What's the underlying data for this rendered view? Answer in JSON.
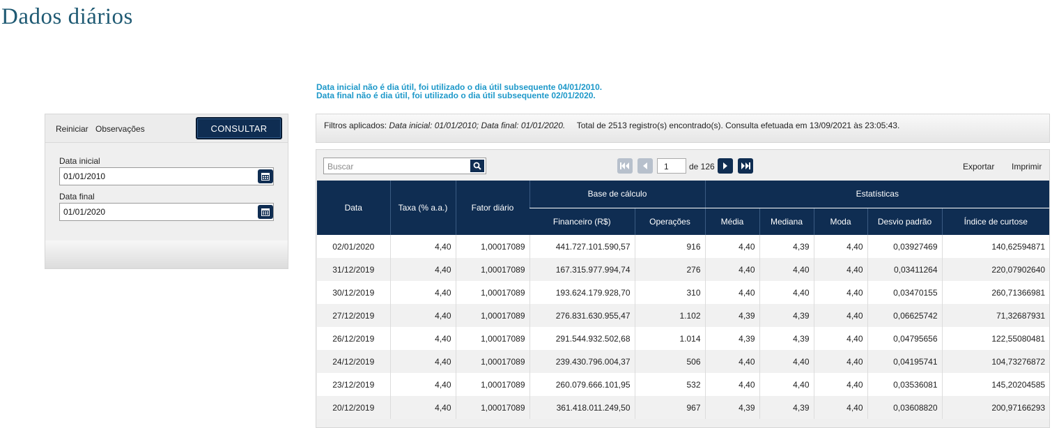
{
  "page": {
    "title": "Dados diários",
    "notice_1": "Data inicial não é dia útil, foi utilizado o dia útil subsequente 04/01/2010.",
    "notice_2": "Data final não é dia útil, foi utilizado o dia útil subsequente 02/01/2020."
  },
  "left_panel": {
    "reset_label": "Reiniciar",
    "notes_label": "Observações",
    "query_label": "CONSULTAR",
    "start_label": "Data inicial",
    "start_value": "01/01/2010",
    "end_label": "Data final",
    "end_value": "01/01/2020"
  },
  "filters": {
    "prefix": "Filtros aplicados:",
    "applied": "Data inicial: 01/01/2010; Data final: 01/01/2020.",
    "summary": "Total de 2513 registro(s) encontrado(s). Consulta efetuada em 13/09/2021 às 23:05:43."
  },
  "table_toolbar": {
    "search_placeholder": "Buscar",
    "page": "1",
    "page_of": "de 126",
    "export_label": "Exportar",
    "print_label": "Imprimir"
  },
  "table": {
    "headers": {
      "data": "Data",
      "taxa": "Taxa (% a.a.)",
      "fator": "Fator diário",
      "base_group": "Base de cálculo",
      "financeiro": "Financeiro (R$)",
      "operacoes": "Operações",
      "stats_group": "Estatísticas",
      "media": "Média",
      "mediana": "Mediana",
      "moda": "Moda",
      "desvio": "Desvio padrão",
      "curtose": "Índice de curtose"
    },
    "rows": [
      [
        "02/01/2020",
        "4,40",
        "1,00017089",
        "441.727.101.590,57",
        "916",
        "4,40",
        "4,39",
        "4,40",
        "0,03927469",
        "140,62594871"
      ],
      [
        "31/12/2019",
        "4,40",
        "1,00017089",
        "167.315.977.994,74",
        "276",
        "4,40",
        "4,40",
        "4,40",
        "0,03411264",
        "220,07902640"
      ],
      [
        "30/12/2019",
        "4,40",
        "1,00017089",
        "193.624.179.928,70",
        "310",
        "4,40",
        "4,40",
        "4,40",
        "0,03470155",
        "260,71366981"
      ],
      [
        "27/12/2019",
        "4,40",
        "1,00017089",
        "276.831.630.955,47",
        "1.102",
        "4,39",
        "4,39",
        "4,40",
        "0,06625742",
        "71,32687931"
      ],
      [
        "26/12/2019",
        "4,40",
        "1,00017089",
        "291.544.932.502,68",
        "1.014",
        "4,39",
        "4,39",
        "4,40",
        "0,04795656",
        "122,55080481"
      ],
      [
        "24/12/2019",
        "4,40",
        "1,00017089",
        "239.430.796.004,37",
        "506",
        "4,40",
        "4,40",
        "4,40",
        "0,04195741",
        "104,73276872"
      ],
      [
        "23/12/2019",
        "4,40",
        "1,00017089",
        "260.079.666.101,95",
        "532",
        "4,40",
        "4,40",
        "4,40",
        "0,03536081",
        "145,20204585"
      ],
      [
        "20/12/2019",
        "4,40",
        "1,00017089",
        "361.418.011.249,50",
        "967",
        "4,39",
        "4,39",
        "4,40",
        "0,03608820",
        "200,97166293"
      ]
    ]
  },
  "icons": {
    "calendar": "calendar-icon",
    "search": "search-icon",
    "first": "first-page-icon",
    "prev": "prev-page-icon",
    "next": "next-page-icon",
    "last": "last-page-icon"
  },
  "colors": {
    "brand_navy": "#0f2d52",
    "title_teal": "#1f5a73",
    "notice_blue": "#1d98c9"
  }
}
